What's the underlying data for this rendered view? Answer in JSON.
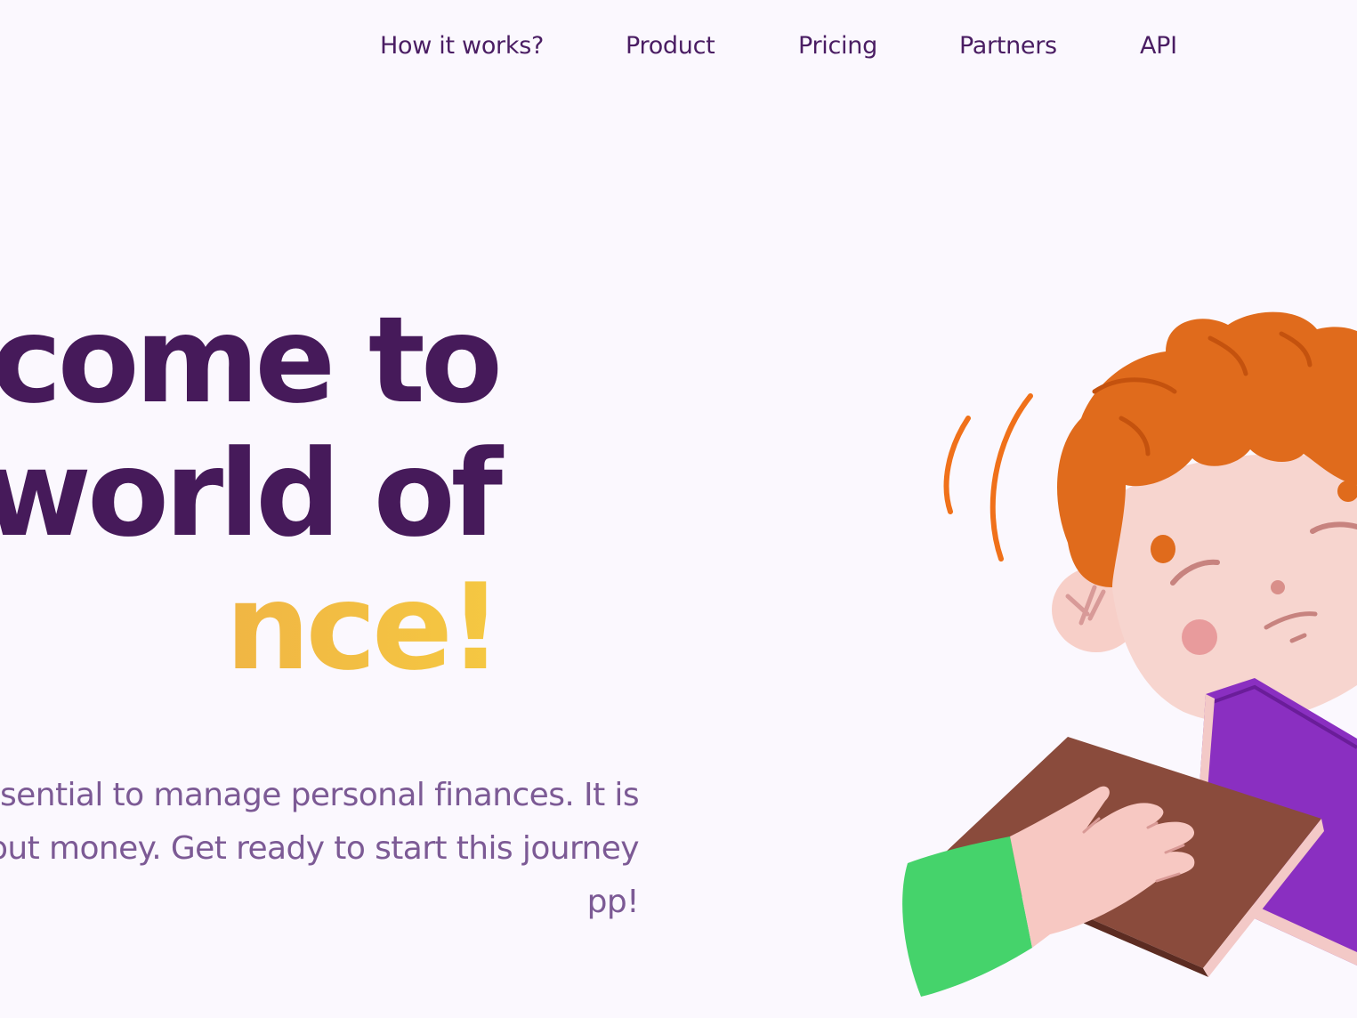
{
  "nav": {
    "items": [
      {
        "label": "How it works?"
      },
      {
        "label": "Product"
      },
      {
        "label": "Pricing"
      },
      {
        "label": "Partners"
      },
      {
        "label": "API"
      }
    ]
  },
  "hero": {
    "title_line_1": "come to",
    "title_line_2": "world of",
    "title_line_3": "nce!",
    "subtitle_line_1": "essential to manage personal finances. It is",
    "subtitle_line_2": "bout money. Get ready to start this journey",
    "subtitle_line_3": "pp!"
  },
  "colors": {
    "background": "#fbf8fe",
    "nav_text": "#4a1d63",
    "title": "#461a5a",
    "accent_start": "#d97a4e",
    "accent_end": "#f5c842",
    "subtitle": "#7c5a95"
  },
  "illustration": {
    "icon": "boy-holding-books-illustration"
  }
}
